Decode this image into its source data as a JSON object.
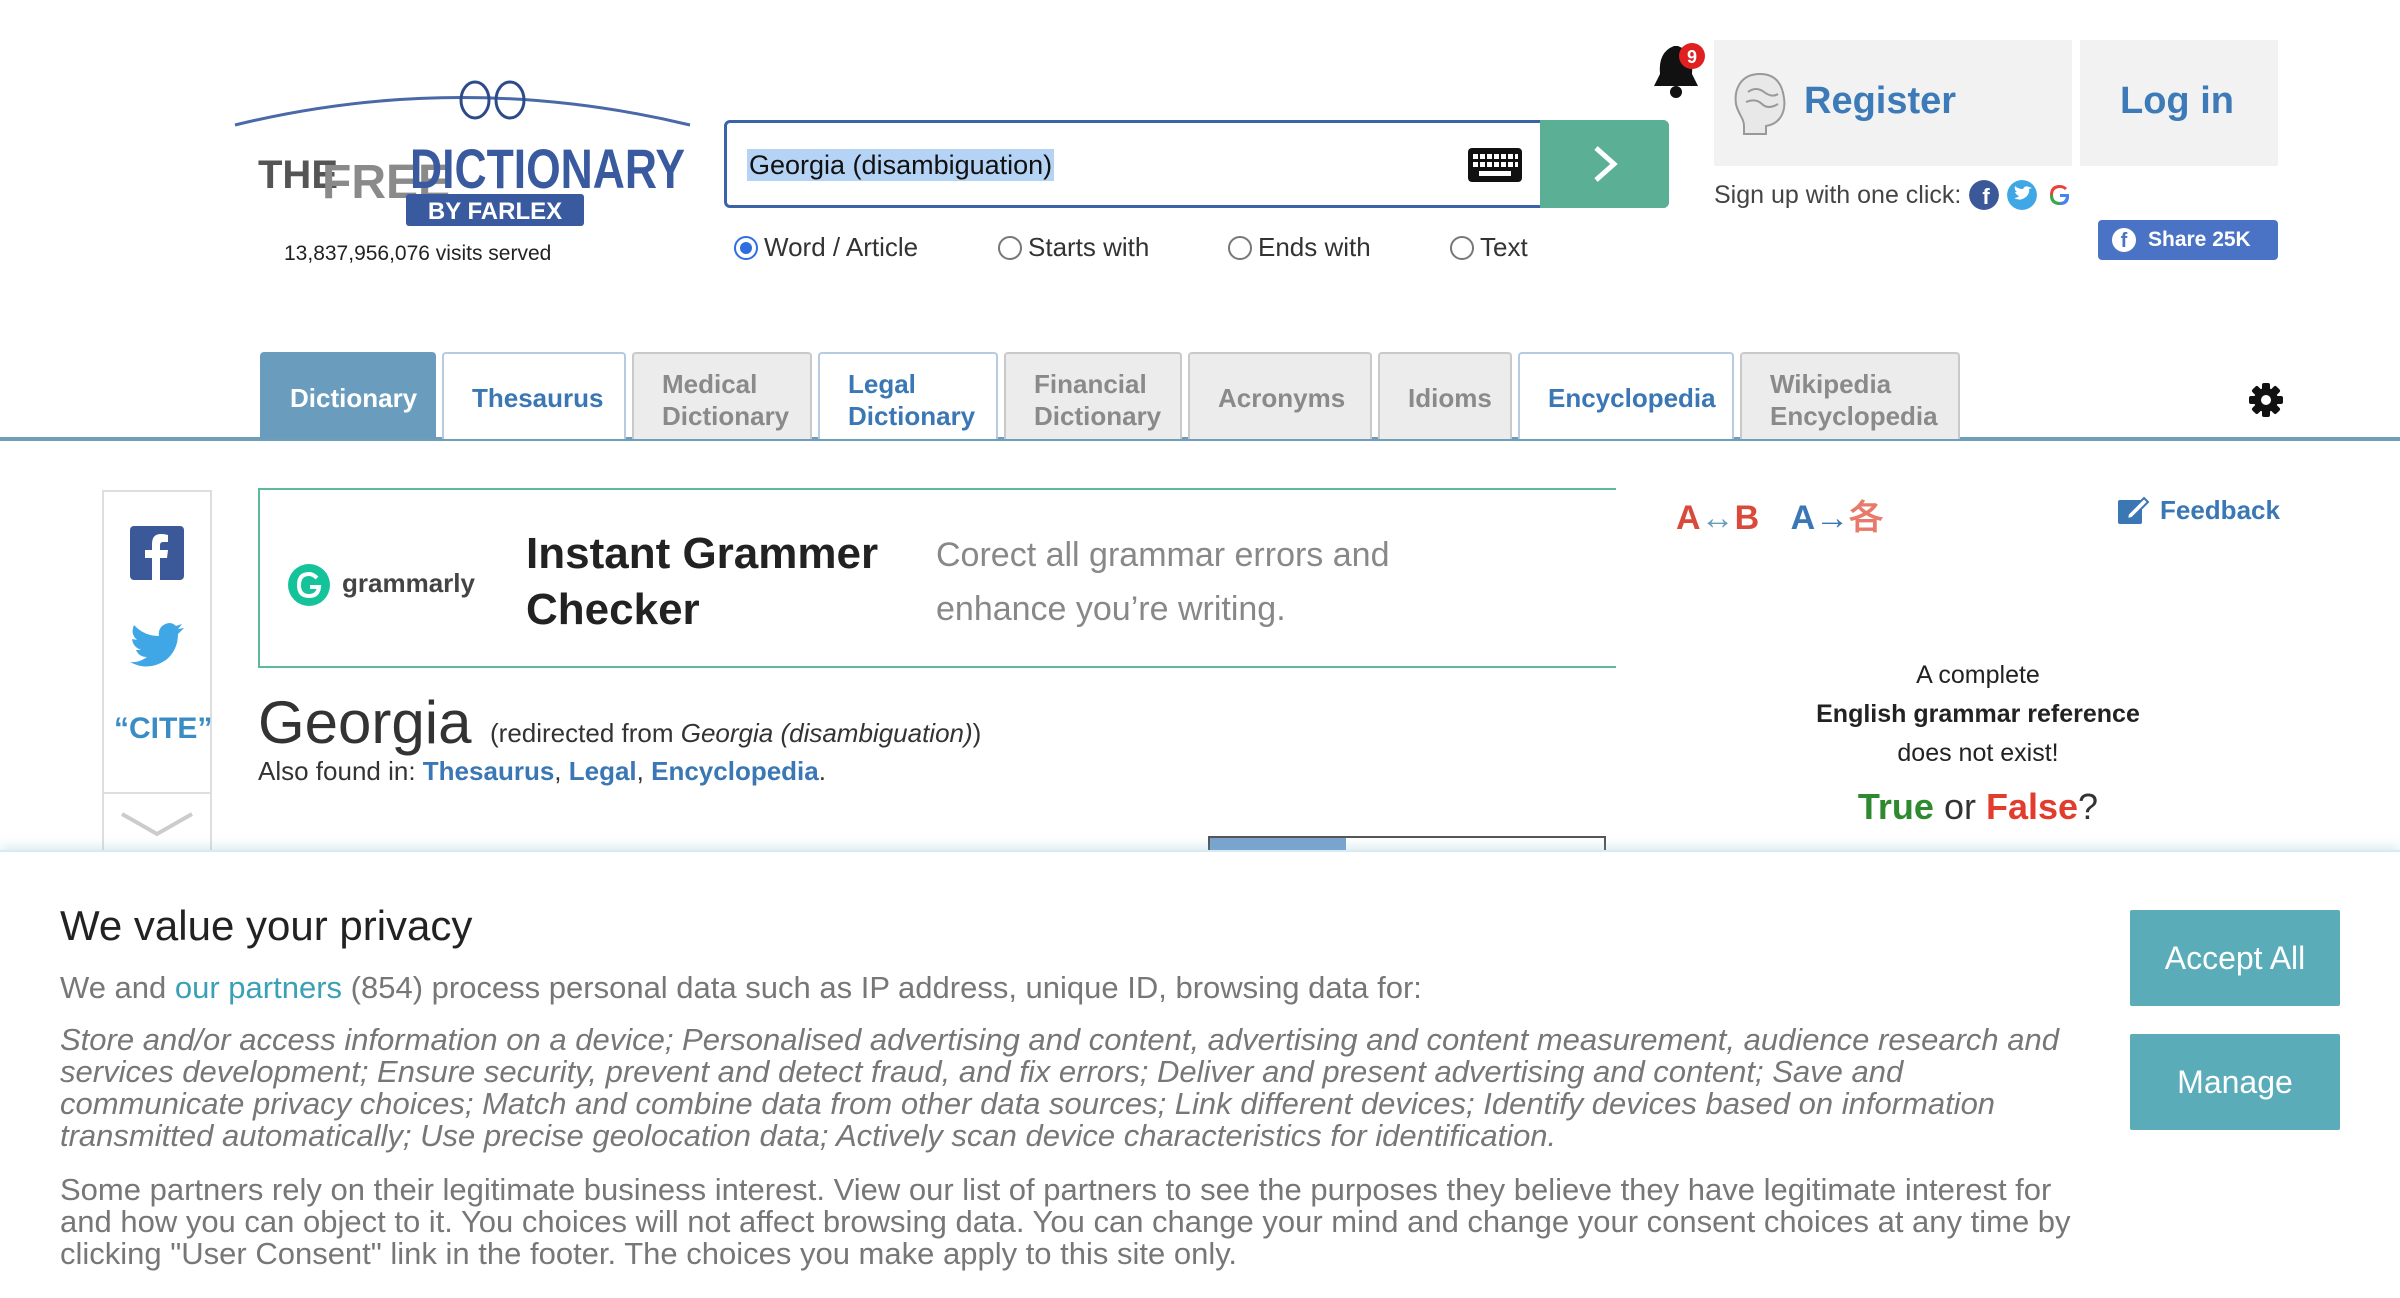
{
  "header": {
    "logo_text": {
      "the": "THE",
      "free": "FREE",
      "dictionary": "DICTIONARY",
      "by": "BY FARLEX"
    },
    "visits": "13,837,956,076 visits served",
    "search": {
      "value": "Georgia (disambiguation)",
      "keyboard_icon": "keyboard-icon",
      "submit_icon": "chevron-right-icon"
    },
    "search_modes": [
      {
        "label": "Word / Article",
        "selected": true
      },
      {
        "label": "Starts with",
        "selected": false
      },
      {
        "label": "Ends with",
        "selected": false
      },
      {
        "label": "Text",
        "selected": false
      }
    ],
    "notifications": {
      "icon": "bell-icon",
      "count": "9"
    },
    "register_label": "Register",
    "login_label": "Log in",
    "signup_text": "Sign up with one click:",
    "share_label": "Share 25K"
  },
  "tabs": [
    {
      "line1": "Dictionary",
      "line2": "",
      "state": "active"
    },
    {
      "line1": "Thesaurus",
      "line2": "",
      "state": "linked"
    },
    {
      "line1": "Medical",
      "line2": "Dictionary",
      "state": "inactive"
    },
    {
      "line1": "Legal",
      "line2": "Dictionary",
      "state": "linked"
    },
    {
      "line1": "Financial",
      "line2": "Dictionary",
      "state": "inactive"
    },
    {
      "line1": "Acronyms",
      "line2": "",
      "state": "inactive"
    },
    {
      "line1": "Idioms",
      "line2": "",
      "state": "inactive"
    },
    {
      "line1": "Encyclopedia",
      "line2": "",
      "state": "linked"
    },
    {
      "line1": "Wikipedia",
      "line2": "Encyclopedia",
      "state": "inactive"
    }
  ],
  "left_bar": {
    "cite_label": "“CITE”"
  },
  "ad": {
    "brand": "grammarly",
    "title": "Instant Grammer Checker",
    "text": "Corect all grammar errors and enhance you’re writing."
  },
  "article": {
    "headword": "Georgia",
    "redirect_prefix": "(redirected from ",
    "redirect_term": "Georgia (disambiguation)",
    "redirect_suffix": ")",
    "also_found_label": "Also found in:",
    "also_found": [
      "Thesaurus",
      "Legal",
      "Encyclopedia"
    ]
  },
  "right_column": {
    "translate_ab": {
      "a": "A",
      "arrow": "↔",
      "b": "B"
    },
    "translate_ax": {
      "a": "A",
      "arrow": "→",
      "cjk": "各"
    },
    "feedback_label": "Feedback",
    "grammar_line1": "A complete",
    "grammar_line2": "English grammar reference",
    "grammar_line3": "does not exist!",
    "tf_true": "True",
    "tf_or": " or ",
    "tf_false": "False",
    "tf_q": "?"
  },
  "consent": {
    "title": "We value your privacy",
    "intro_pre": "We and ",
    "intro_link": "our partners",
    "intro_post": " (854) process personal data such as IP address, unique ID, browsing data for:",
    "purposes": "Store and/or access information on a device; Personalised advertising and content, advertising and content measurement, audience research and services development; Ensure security, prevent and detect fraud, and fix errors; Deliver and present advertising and content; Save and communicate privacy choices; Match and combine data from other data sources; Link different devices; Identify devices based on information transmitted automatically; Use precise geolocation data; Actively scan device characteristics for identification.",
    "legit": "Some partners rely on their legitimate business interest. View our list of partners to see the purposes they believe they have legitimate interest for and how you can object to it. You choices will not affect browsing data. You can change your mind and change your consent choices at any time by clicking \"User Consent\" link in the footer. The choices you make apply to this site only.",
    "accept_label": "Accept All",
    "manage_label": "Manage"
  },
  "colors": {
    "accent_blue": "#3a77b4",
    "tab_active": "#6a9dbd",
    "search_green": "#5aaf95",
    "consent_button": "#5aacb8"
  }
}
